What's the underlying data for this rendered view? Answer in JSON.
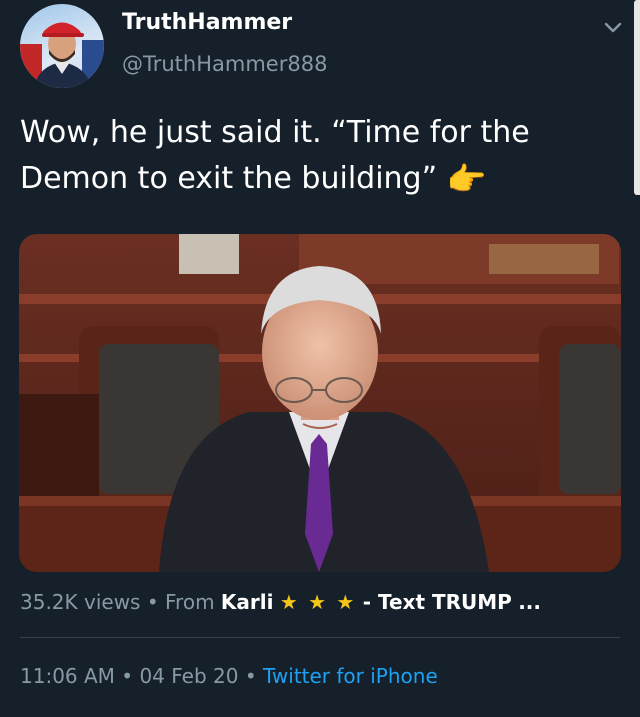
{
  "tweet": {
    "display_name": "TruthHammer",
    "handle": "@TruthHammer888",
    "text_part1": "Wow, he just said it. “Time for the Demon to exit the building”",
    "emoji": "👉",
    "media": {
      "views": "35.2K views",
      "separator": "•",
      "from_label": "From",
      "source_name": "Karli",
      "stars": "★ ★ ★",
      "source_suffix": "- Text TRUMP",
      "ellipsis": "..."
    },
    "time": "11:06 AM",
    "date_separator": "•",
    "date": "04 Feb 20",
    "client_separator": "•",
    "client": "Twitter for iPhone"
  },
  "colors": {
    "background": "#15202b",
    "secondary_text": "#8899a6",
    "link": "#1da1f2",
    "star": "#f5c518"
  },
  "icons": {
    "caret": "chevron-down-icon",
    "pointing": "backhand-index-pointing-right-emoji"
  }
}
